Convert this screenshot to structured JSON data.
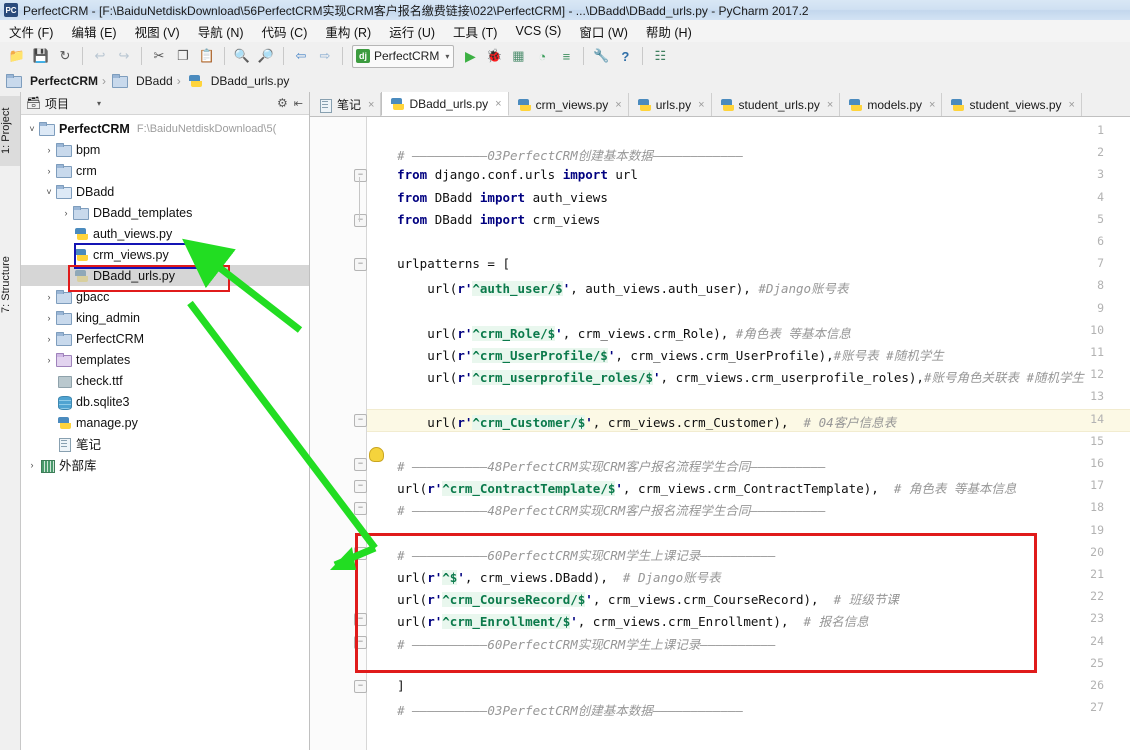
{
  "window": {
    "title": "PerfectCRM - [F:\\BaiduNetdiskDownload\\56PerfectCRM实现CRM客户报名缴费链接\\022\\PerfectCRM] - ...\\DBadd\\DBadd_urls.py - PyCharm 2017.2",
    "app_icon": "PC"
  },
  "menubar": {
    "items": [
      {
        "label": "文件 (F)"
      },
      {
        "label": "编辑 (E)"
      },
      {
        "label": "视图 (V)"
      },
      {
        "label": "导航 (N)"
      },
      {
        "label": "代码 (C)"
      },
      {
        "label": "重构 (R)"
      },
      {
        "label": "运行 (U)"
      },
      {
        "label": "工具 (T)"
      },
      {
        "label": "VCS (S)"
      },
      {
        "label": "窗口 (W)"
      },
      {
        "label": "帮助 (H)"
      }
    ]
  },
  "toolbar": {
    "buttons": [
      {
        "name": "open-folder-icon",
        "glyph": "📂"
      },
      {
        "name": "save-all-icon",
        "glyph": "💾"
      },
      {
        "name": "sync-icon",
        "glyph": "↻"
      },
      {
        "name": "undo-icon",
        "glyph": "↩"
      },
      {
        "name": "redo-icon",
        "glyph": "↪"
      },
      {
        "name": "cut-icon",
        "glyph": "✂"
      },
      {
        "name": "copy-icon",
        "glyph": "❐"
      },
      {
        "name": "paste-icon",
        "glyph": "📋"
      },
      {
        "name": "find-icon",
        "glyph": "🔍"
      },
      {
        "name": "replace-icon",
        "glyph": "🔎"
      },
      {
        "name": "back-icon",
        "glyph": "⇦"
      },
      {
        "name": "forward-icon",
        "glyph": "⇨"
      }
    ],
    "run_config": {
      "icon_text": "dj",
      "label": "PerfectCRM",
      "caret": "▾"
    },
    "run_buttons": [
      {
        "name": "run-icon",
        "glyph": "▶"
      },
      {
        "name": "debug-icon",
        "glyph": "🐞"
      },
      {
        "name": "coverage-icon",
        "glyph": "▦"
      },
      {
        "name": "profile-icon",
        "glyph": "◔"
      },
      {
        "name": "run-with-console-icon",
        "glyph": "≡"
      }
    ],
    "right_buttons": [
      {
        "name": "settings-icon",
        "glyph": "🔧"
      },
      {
        "name": "help-icon",
        "glyph": "?"
      },
      {
        "name": "project-structure-icon",
        "glyph": "☷"
      }
    ]
  },
  "breadcrumb": {
    "items": [
      {
        "label": "PerfectCRM",
        "icon": "folder-icon",
        "bold": true
      },
      {
        "label": "DBadd",
        "icon": "folder-icon",
        "bold": false
      },
      {
        "label": "DBadd_urls.py",
        "icon": "python-file-icon",
        "bold": false
      }
    ],
    "separator": "›"
  },
  "left_strip": {
    "tabs": [
      {
        "label": "1: Project",
        "selected": true
      },
      {
        "label": "7: Structure",
        "selected": false
      }
    ]
  },
  "project_panel": {
    "header": {
      "title": "项目",
      "caret": "▾",
      "gear": "⚙",
      "collapse": "⇤"
    },
    "tree": [
      {
        "indent": 0,
        "twist": "˅",
        "icon": "folder-open-icon",
        "label": "PerfectCRM",
        "bold": true,
        "path": "F:\\BaiduNetdiskDownload\\5(",
        "selected": false
      },
      {
        "indent": 1,
        "twist": "›",
        "icon": "folder-icon",
        "label": "bpm",
        "bold": false,
        "path": "",
        "selected": false
      },
      {
        "indent": 1,
        "twist": "›",
        "icon": "folder-icon",
        "label": "crm",
        "bold": false,
        "path": "",
        "selected": false
      },
      {
        "indent": 1,
        "twist": "˅",
        "icon": "folder-open-icon",
        "label": "DBadd",
        "bold": false,
        "path": "",
        "selected": false
      },
      {
        "indent": 2,
        "twist": "›",
        "icon": "folder-icon",
        "label": "DBadd_templates",
        "bold": false,
        "path": "",
        "selected": false
      },
      {
        "indent": 2,
        "twist": "",
        "icon": "python-file-icon",
        "label": "auth_views.py",
        "bold": false,
        "path": "",
        "selected": false
      },
      {
        "indent": 2,
        "twist": "",
        "icon": "python-file-icon",
        "label": "crm_views.py",
        "bold": false,
        "path": "",
        "selected": false
      },
      {
        "indent": 2,
        "twist": "",
        "icon": "python-file-gray-icon",
        "label": "DBadd_urls.py",
        "bold": false,
        "path": "",
        "selected": true
      },
      {
        "indent": 1,
        "twist": "›",
        "icon": "folder-icon",
        "label": "gbacc",
        "bold": false,
        "path": "",
        "selected": false
      },
      {
        "indent": 1,
        "twist": "›",
        "icon": "folder-icon",
        "label": "king_admin",
        "bold": false,
        "path": "",
        "selected": false
      },
      {
        "indent": 1,
        "twist": "›",
        "icon": "folder-icon",
        "label": "PerfectCRM",
        "bold": false,
        "path": "",
        "selected": false
      },
      {
        "indent": 1,
        "twist": "›",
        "icon": "folder-purple-icon",
        "label": "templates",
        "bold": false,
        "path": "",
        "selected": false
      },
      {
        "indent": 1,
        "twist": "",
        "icon": "font-file-icon",
        "label": "check.ttf",
        "bold": false,
        "path": "",
        "selected": false
      },
      {
        "indent": 1,
        "twist": "",
        "icon": "database-file-icon",
        "label": "db.sqlite3",
        "bold": false,
        "path": "",
        "selected": false
      },
      {
        "indent": 1,
        "twist": "",
        "icon": "python-file-icon",
        "label": "manage.py",
        "bold": false,
        "path": "",
        "selected": false
      },
      {
        "indent": 1,
        "twist": "",
        "icon": "note-file-icon",
        "label": "笔记",
        "bold": false,
        "path": "",
        "selected": false
      },
      {
        "indent": 0,
        "twist": "›",
        "icon": "library-icon",
        "label": "外部库",
        "bold": false,
        "path": "",
        "selected": false
      }
    ]
  },
  "editor": {
    "tabs": [
      {
        "label": "笔记",
        "icon": "note-file-icon",
        "active": false
      },
      {
        "label": "DBadd_urls.py",
        "icon": "python-file-icon",
        "active": true
      },
      {
        "label": "crm_views.py",
        "icon": "python-file-icon",
        "active": false
      },
      {
        "label": "urls.py",
        "icon": "python-file-icon",
        "active": false
      },
      {
        "label": "student_urls.py",
        "icon": "python-file-icon",
        "active": false
      },
      {
        "label": "models.py",
        "icon": "python-file-icon",
        "active": false
      },
      {
        "label": "student_views.py",
        "icon": "python-file-icon",
        "active": false
      }
    ],
    "close_glyph": "×",
    "highlighted_line": 14,
    "lines": [
      {
        "n": 1,
        "tokens": []
      },
      {
        "n": 2,
        "tokens": [
          {
            "t": "cm",
            "s": "    # ——————————03PerfectCRM创建基本数据————————————"
          }
        ]
      },
      {
        "n": 3,
        "tokens": [
          {
            "t": "kw",
            "s": "    from"
          },
          {
            "t": "pl",
            "s": " django.conf.urls "
          },
          {
            "t": "kw",
            "s": "import"
          },
          {
            "t": "pl",
            "s": " url"
          }
        ]
      },
      {
        "n": 4,
        "tokens": [
          {
            "t": "kw",
            "s": "    from"
          },
          {
            "t": "pl",
            "s": " DBadd "
          },
          {
            "t": "kw",
            "s": "import"
          },
          {
            "t": "pl",
            "s": " auth_views"
          }
        ]
      },
      {
        "n": 5,
        "tokens": [
          {
            "t": "kw",
            "s": "    from"
          },
          {
            "t": "pl",
            "s": " DBadd "
          },
          {
            "t": "kw",
            "s": "import"
          },
          {
            "t": "pl",
            "s": " crm_views"
          }
        ]
      },
      {
        "n": 6,
        "tokens": []
      },
      {
        "n": 7,
        "tokens": [
          {
            "t": "pl",
            "s": "    urlpatterns = ["
          }
        ]
      },
      {
        "n": 8,
        "tokens": [
          {
            "t": "pl",
            "s": "        url("
          },
          {
            "t": "rpfx",
            "s": "r'"
          },
          {
            "t": "str",
            "s": "^auth_user/$"
          },
          {
            "t": "rpfx",
            "s": "'"
          },
          {
            "t": "pl",
            "s": ", auth_views.auth_user), "
          },
          {
            "t": "cm",
            "s": "#Django账号表"
          }
        ]
      },
      {
        "n": 9,
        "tokens": []
      },
      {
        "n": 10,
        "tokens": [
          {
            "t": "pl",
            "s": "        url("
          },
          {
            "t": "rpfx",
            "s": "r'"
          },
          {
            "t": "str",
            "s": "^crm_Role/$"
          },
          {
            "t": "rpfx",
            "s": "'"
          },
          {
            "t": "pl",
            "s": ", crm_views.crm_Role), "
          },
          {
            "t": "cm",
            "s": "#角色表 等基本信息"
          }
        ]
      },
      {
        "n": 11,
        "tokens": [
          {
            "t": "pl",
            "s": "        url("
          },
          {
            "t": "rpfx",
            "s": "r'"
          },
          {
            "t": "str",
            "s": "^crm_UserProfile/$"
          },
          {
            "t": "rpfx",
            "s": "'"
          },
          {
            "t": "pl",
            "s": ", crm_views.crm_UserProfile),"
          },
          {
            "t": "cm",
            "s": "#账号表 #随机学生"
          }
        ]
      },
      {
        "n": 12,
        "tokens": [
          {
            "t": "pl",
            "s": "        url("
          },
          {
            "t": "rpfx",
            "s": "r'"
          },
          {
            "t": "str",
            "s": "^crm_userprofile_roles/$"
          },
          {
            "t": "rpfx",
            "s": "'"
          },
          {
            "t": "pl",
            "s": ", crm_views.crm_userprofile_roles),"
          },
          {
            "t": "cm",
            "s": "#账号角色关联表 #随机学生"
          }
        ]
      },
      {
        "n": 13,
        "tokens": []
      },
      {
        "n": 14,
        "tokens": [
          {
            "t": "pl",
            "s": "        url("
          },
          {
            "t": "rpfx",
            "s": "r'"
          },
          {
            "t": "str",
            "s": "^crm_Customer/$"
          },
          {
            "t": "rpfx",
            "s": "'"
          },
          {
            "t": "pl",
            "s": ", crm_views.crm_Customer),  "
          },
          {
            "t": "cm",
            "s": "# 04客户信息表"
          }
        ]
      },
      {
        "n": 15,
        "tokens": []
      },
      {
        "n": 16,
        "tokens": [
          {
            "t": "cm",
            "s": "    # ——————————48PerfectCRM实现CRM客户报名流程学生合同——————————"
          }
        ]
      },
      {
        "n": 17,
        "tokens": [
          {
            "t": "pl",
            "s": "    url("
          },
          {
            "t": "rpfx",
            "s": "r'"
          },
          {
            "t": "str",
            "s": "^crm_ContractTemplate/$"
          },
          {
            "t": "rpfx",
            "s": "'"
          },
          {
            "t": "pl",
            "s": ", crm_views.crm_ContractTemplate),  "
          },
          {
            "t": "cm",
            "s": "# 角色表 等基本信息"
          }
        ]
      },
      {
        "n": 18,
        "tokens": [
          {
            "t": "cm",
            "s": "    # ——————————48PerfectCRM实现CRM客户报名流程学生合同——————————"
          }
        ]
      },
      {
        "n": 19,
        "tokens": []
      },
      {
        "n": 20,
        "tokens": [
          {
            "t": "cm",
            "s": "    # ——————————60PerfectCRM实现CRM学生上课记录——————————"
          }
        ]
      },
      {
        "n": 21,
        "tokens": [
          {
            "t": "pl",
            "s": "    url("
          },
          {
            "t": "rpfx",
            "s": "r'"
          },
          {
            "t": "str",
            "s": "^$"
          },
          {
            "t": "rpfx",
            "s": "'"
          },
          {
            "t": "pl",
            "s": ", crm_views.DBadd),  "
          },
          {
            "t": "cm",
            "s": "# Django账号表"
          }
        ]
      },
      {
        "n": 22,
        "tokens": [
          {
            "t": "pl",
            "s": "    url("
          },
          {
            "t": "rpfx",
            "s": "r'"
          },
          {
            "t": "str",
            "s": "^crm_CourseRecord/$"
          },
          {
            "t": "rpfx",
            "s": "'"
          },
          {
            "t": "pl",
            "s": ", crm_views.crm_CourseRecord),  "
          },
          {
            "t": "cm",
            "s": "# 班级节课"
          }
        ]
      },
      {
        "n": 23,
        "tokens": [
          {
            "t": "pl",
            "s": "    url("
          },
          {
            "t": "rpfx",
            "s": "r'"
          },
          {
            "t": "str",
            "s": "^crm_Enrollment/$"
          },
          {
            "t": "rpfx",
            "s": "'"
          },
          {
            "t": "pl",
            "s": ", crm_views.crm_Enrollment),  "
          },
          {
            "t": "cm",
            "s": "# 报名信息"
          }
        ]
      },
      {
        "n": 24,
        "tokens": [
          {
            "t": "cm",
            "s": "    # ——————————60PerfectCRM实现CRM学生上课记录——————————"
          }
        ]
      },
      {
        "n": 25,
        "tokens": []
      },
      {
        "n": 26,
        "tokens": [
          {
            "t": "pl",
            "s": "    ]"
          }
        ]
      },
      {
        "n": 27,
        "tokens": [
          {
            "t": "cm",
            "s": "    # ——————————03PerfectCRM创建基本数据————————————"
          }
        ]
      }
    ]
  },
  "annotations": {
    "blue_box_label": "crm_views.py",
    "red_box_label": "DBadd_urls.py",
    "red_region_label": "60PerfectCRM实现CRM学生上课记录 block",
    "colors": {
      "blue": "#1414b4",
      "red": "#e01b1b",
      "green": "#22dd22"
    }
  }
}
